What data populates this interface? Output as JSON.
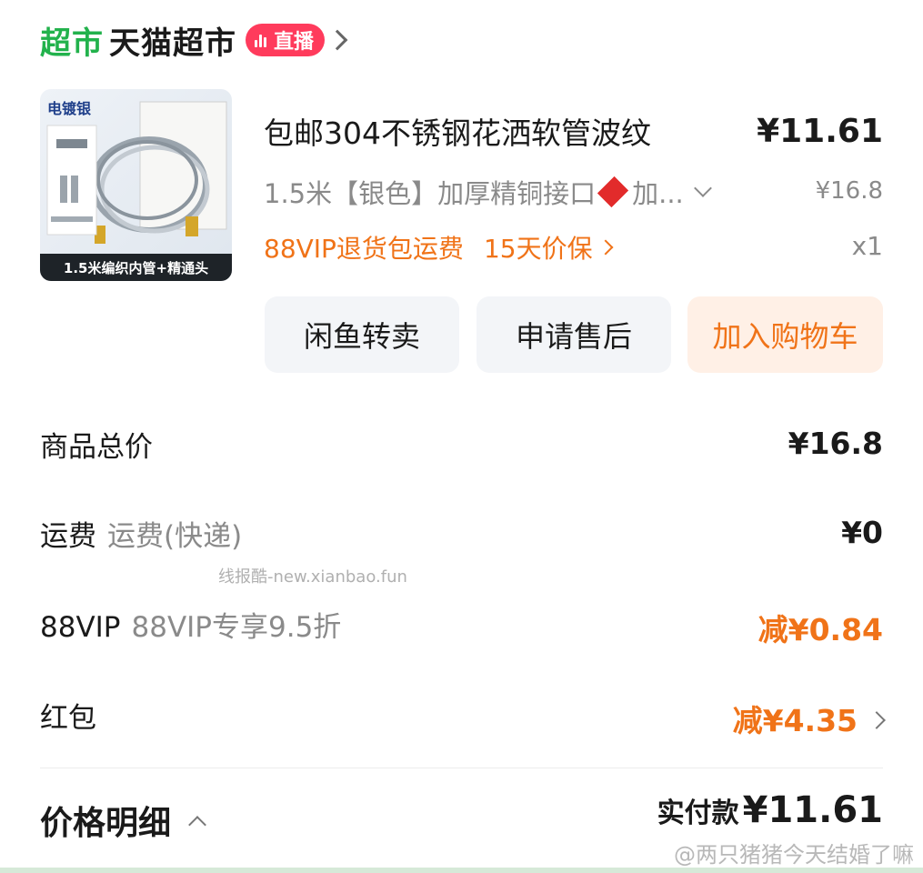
{
  "store": {
    "logo_text": "超市",
    "name": "天猫超市",
    "live_label": "直播",
    "brand_color": "#22b24c",
    "live_color": "#ff3b5c"
  },
  "product": {
    "image_tag": "电镀银",
    "image_caption": "1.5米编织内管+精通头",
    "title": "包邮304不锈钢花洒软管波纹",
    "price": "¥11.61",
    "spec_prefix": "1.5米【银色】加厚精铜接口",
    "spec_suffix": "加...",
    "original_price": "¥16.8",
    "service_return": "88VIP退货包运费",
    "service_price_protect": "15天价保",
    "quantity": "x1"
  },
  "actions": {
    "resell": "闲鱼转卖",
    "after_sales": "申请售后",
    "add_cart": "加入购物车"
  },
  "summary": {
    "total_label": "商品总价",
    "total_value": "¥16.8",
    "shipping_label": "运费",
    "shipping_sub": "运费(快递)",
    "shipping_value": "¥0",
    "vip_label": "88VIP",
    "vip_sub": "88VIP专享9.5折",
    "vip_value": "减¥0.84",
    "redpacket_label": "红包",
    "redpacket_value": "减¥4.35"
  },
  "footer": {
    "detail_label": "价格明细",
    "paid_label": "实付款",
    "paid_value": "¥11.61"
  },
  "watermarks": {
    "middle": "线报酷-new.xianbao.fun",
    "weibo": "@两只猪猪今天结婚了嘛"
  },
  "accent_color": "#f07318"
}
